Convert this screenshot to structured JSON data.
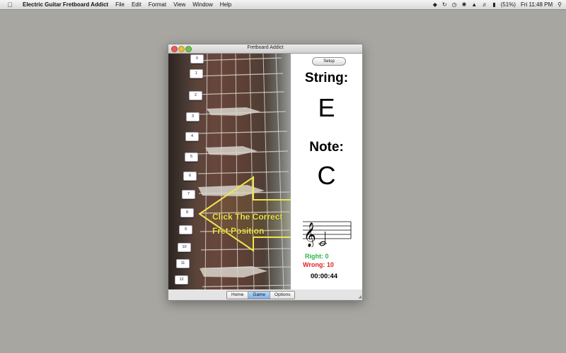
{
  "menubar": {
    "apple_icon": "apple-icon",
    "app_name": "Electric Guitar Fretboard Addict",
    "menus": [
      "File",
      "Edit",
      "Format",
      "View",
      "Window",
      "Help"
    ],
    "battery": "(51%)",
    "clock": "Fri 11:48 PM",
    "tray_icons": [
      "dropbox-icon",
      "sync-icon",
      "time-machine-icon",
      "bluetooth-icon",
      "wifi-icon",
      "volume-icon",
      "battery-icon",
      "search-icon"
    ]
  },
  "window": {
    "title": "Fretboard Addict"
  },
  "fretboard": {
    "frets": [
      "0",
      "1",
      "2",
      "3",
      "4",
      "5",
      "6",
      "7",
      "8",
      "9",
      "10",
      "11",
      "12"
    ],
    "prompt_line1": "Click The Correct",
    "prompt_line2": "Fret Position",
    "arrow_color": "#f1e64a"
  },
  "panel": {
    "setup_label": "Setup",
    "string_label": "String:",
    "string_value": "E",
    "note_label": "Note:",
    "note_value": "C",
    "right_label": "Right: 0",
    "wrong_label": "Wrong: 10",
    "timer": "00:00:44",
    "right_color": "#2db54a",
    "wrong_color": "#e02020"
  },
  "tabs": {
    "items": [
      "Home",
      "Game",
      "Options"
    ],
    "active": "Game"
  }
}
